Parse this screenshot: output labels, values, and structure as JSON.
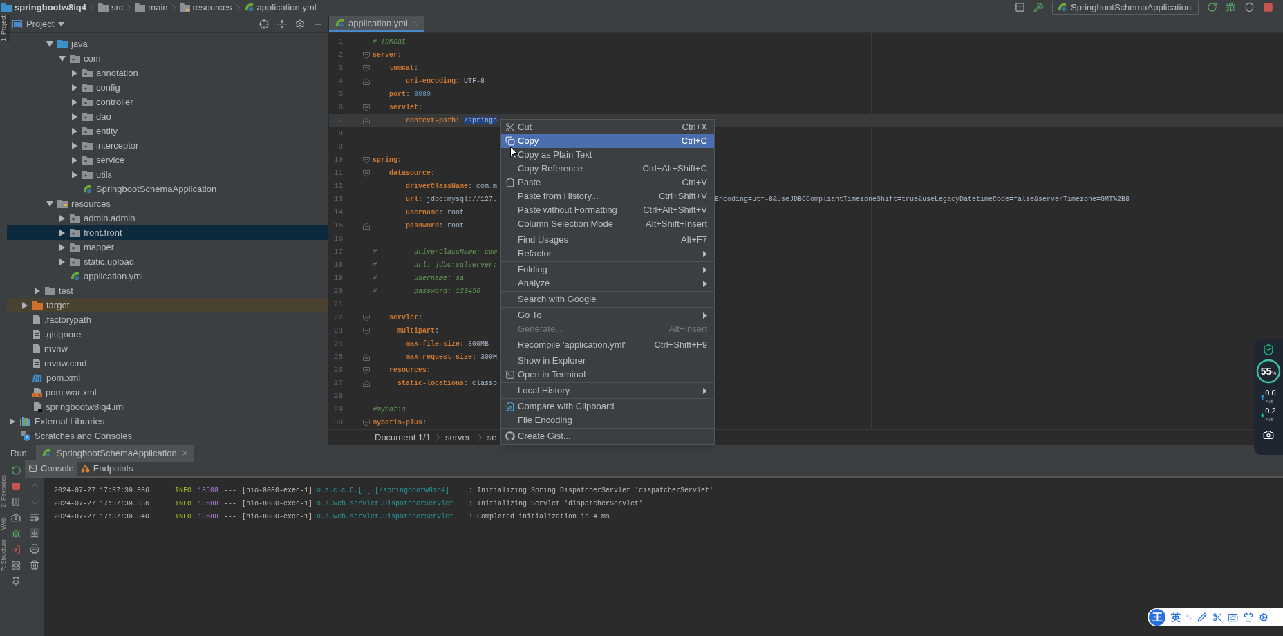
{
  "breadcrumb": [
    {
      "label": "springbootw8iq4",
      "kind": "module"
    },
    {
      "label": "src",
      "kind": "folder"
    },
    {
      "label": "main",
      "kind": "folder"
    },
    {
      "label": "resources",
      "kind": "resources"
    },
    {
      "label": "application.yml",
      "kind": "spring"
    }
  ],
  "run_configuration": {
    "label": "SpringbootSchemaApplication"
  },
  "left_strip_top": [
    "1: Project"
  ],
  "left_strip_bottom": [
    "2: Favorites",
    "Web",
    "7: Structure"
  ],
  "project_panel": {
    "title": "Project",
    "main_items": [
      {
        "label": "java",
        "kind": "source",
        "expanded": true,
        "selected": false,
        "children": [
          {
            "label": "com",
            "kind": "package",
            "expanded": true,
            "selected": false,
            "children": [
              {
                "label": "annotation",
                "kind": "package",
                "expanded": false,
                "selected": false
              },
              {
                "label": "config",
                "kind": "package",
                "expanded": false,
                "selected": false
              },
              {
                "label": "controller",
                "kind": "package",
                "expanded": false,
                "selected": false
              },
              {
                "label": "dao",
                "kind": "package",
                "expanded": false,
                "selected": false
              },
              {
                "label": "entity",
                "kind": "package",
                "expanded": false,
                "selected": false
              },
              {
                "label": "interceptor",
                "kind": "package",
                "expanded": false,
                "selected": false
              },
              {
                "label": "service",
                "kind": "package",
                "expanded": false,
                "selected": false
              },
              {
                "label": "utils",
                "kind": "package",
                "expanded": false,
                "selected": false
              },
              {
                "label": "SpringbootSchemaApplication",
                "kind": "spring",
                "selected": false
              }
            ]
          }
        ]
      },
      {
        "label": "resources",
        "kind": "resources",
        "expanded": true,
        "selected": false,
        "children": [
          {
            "label": "admin.admin",
            "kind": "package",
            "expanded": false,
            "selected": false
          },
          {
            "label": "front.front",
            "kind": "package",
            "expanded": false,
            "selected": true
          },
          {
            "label": "mapper",
            "kind": "package",
            "expanded": false,
            "selected": false
          },
          {
            "label": "static.upload",
            "kind": "package",
            "expanded": false,
            "selected": false
          },
          {
            "label": "application.yml",
            "kind": "spring",
            "selected": false
          }
        ]
      }
    ],
    "src_items": [
      {
        "label": "test",
        "kind": "folder",
        "expanded": false,
        "selected": false
      }
    ],
    "module_items": [
      {
        "label": "target",
        "kind": "excluded",
        "expanded": false,
        "selected": false
      },
      {
        "label": ".factorypath",
        "kind": "file",
        "selected": false
      },
      {
        "label": ".gitignore",
        "kind": "file",
        "selected": false
      },
      {
        "label": "mvnw",
        "kind": "file",
        "selected": false
      },
      {
        "label": "mvnw.cmd",
        "kind": "file",
        "selected": false
      },
      {
        "label": "pom.xml",
        "kind": "maven",
        "selected": false
      },
      {
        "label": "pom-war.xml",
        "kind": "xml",
        "selected": false
      },
      {
        "label": "springbootw8iq4.iml",
        "kind": "iml",
        "selected": false
      }
    ],
    "root_items": [
      {
        "label": "External Libraries",
        "kind": "libraries",
        "expanded": false,
        "selected": false
      },
      {
        "label": "Scratches and Consoles",
        "kind": "scratches",
        "selected": false
      }
    ]
  },
  "editor": {
    "tab": {
      "label": "application.yml"
    },
    "lines": [
      {
        "number": "1",
        "current": false,
        "fold_open": false,
        "fold_close": false,
        "segments": [
          {
            "text": "# Tomcat",
            "kind": "comment"
          }
        ]
      },
      {
        "number": "2",
        "current": false,
        "fold_open": true,
        "fold_close": false,
        "segments": [
          {
            "text": "server",
            "kind": "key"
          },
          {
            "text": ":",
            "kind": "colon"
          }
        ]
      },
      {
        "number": "3",
        "current": false,
        "fold_open": true,
        "fold_close": false,
        "segments": [
          {
            "text": "    tomcat",
            "kind": "key"
          },
          {
            "text": ":",
            "kind": "colon"
          }
        ]
      },
      {
        "number": "4",
        "current": false,
        "fold_open": false,
        "fold_close": true,
        "segments": [
          {
            "text": "        uri-encoding",
            "kind": "key"
          },
          {
            "text": ": ",
            "kind": "colon"
          },
          {
            "text": "UTF-8",
            "kind": "value"
          }
        ]
      },
      {
        "number": "5",
        "current": false,
        "fold_open": false,
        "fold_close": false,
        "segments": [
          {
            "text": "    port",
            "kind": "key"
          },
          {
            "text": ": ",
            "kind": "colon"
          },
          {
            "text": "8080",
            "kind": "number"
          }
        ]
      },
      {
        "number": "6",
        "current": false,
        "fold_open": true,
        "fold_close": false,
        "segments": [
          {
            "text": "    servlet",
            "kind": "key"
          },
          {
            "text": ":",
            "kind": "colon"
          }
        ]
      },
      {
        "number": "7",
        "current": true,
        "fold_open": false,
        "fold_close": true,
        "segments": [
          {
            "text": "        context-path",
            "kind": "key"
          },
          {
            "text": ": ",
            "kind": "colon"
          },
          {
            "text": "/springb",
            "kind": "selected"
          }
        ]
      },
      {
        "number": "8",
        "current": false,
        "fold_open": false,
        "fold_close": false
      },
      {
        "number": "9",
        "current": false,
        "fold_open": false,
        "fold_close": false
      },
      {
        "number": "10",
        "current": false,
        "fold_open": true,
        "fold_close": false,
        "segments": [
          {
            "text": "spring",
            "kind": "key"
          },
          {
            "text": ":",
            "kind": "colon"
          }
        ]
      },
      {
        "number": "11",
        "current": false,
        "fold_open": true,
        "fold_close": false,
        "segments": [
          {
            "text": "    datasource",
            "kind": "key"
          },
          {
            "text": ":",
            "kind": "colon"
          }
        ]
      },
      {
        "number": "12",
        "current": false,
        "fold_open": false,
        "fold_close": false,
        "segments": [
          {
            "text": "        driverClassName",
            "kind": "key"
          },
          {
            "text": ": ",
            "kind": "colon"
          },
          {
            "text": "com.m",
            "kind": "value"
          }
        ]
      },
      {
        "number": "13",
        "current": false,
        "fold_open": false,
        "fold_close": false,
        "segments": [
          {
            "text": "        url",
            "kind": "key"
          },
          {
            "text": ": ",
            "kind": "colon"
          },
          {
            "text": "jdbc:mysql://127.",
            "kind": "value"
          }
        ],
        "overflow": "Encoding=utf-8&useJDBCCompliantTimezoneShift=true&useLegacyDatetimeCode=false&serverTimezone=GMT%2B8"
      },
      {
        "number": "14",
        "current": false,
        "fold_open": false,
        "fold_close": false,
        "segments": [
          {
            "text": "        username",
            "kind": "key"
          },
          {
            "text": ": ",
            "kind": "colon"
          },
          {
            "text": "root",
            "kind": "value"
          }
        ]
      },
      {
        "number": "15",
        "current": false,
        "fold_open": false,
        "fold_close": true,
        "segments": [
          {
            "text": "        password",
            "kind": "key"
          },
          {
            "text": ": ",
            "kind": "colon"
          },
          {
            "text": "root",
            "kind": "value"
          }
        ]
      },
      {
        "number": "16",
        "current": false,
        "fold_open": false,
        "fold_close": false
      },
      {
        "number": "17",
        "current": false,
        "fold_open": false,
        "fold_close": false,
        "segments": [
          {
            "text": "#         driverClassName: com",
            "kind": "comment"
          }
        ]
      },
      {
        "number": "18",
        "current": false,
        "fold_open": false,
        "fold_close": false,
        "segments": [
          {
            "text": "#         url: jdbc:sqlserver:",
            "kind": "comment"
          }
        ]
      },
      {
        "number": "19",
        "current": false,
        "fold_open": false,
        "fold_close": false,
        "segments": [
          {
            "text": "#         username: sa",
            "kind": "comment"
          }
        ]
      },
      {
        "number": "20",
        "current": false,
        "fold_open": false,
        "fold_close": false,
        "segments": [
          {
            "text": "#         password: 123456",
            "kind": "comment"
          }
        ]
      },
      {
        "number": "21",
        "current": false,
        "fold_open": false,
        "fold_close": false
      },
      {
        "number": "22",
        "current": false,
        "fold_open": true,
        "fold_close": false,
        "segments": [
          {
            "text": "    servlet",
            "kind": "key"
          },
          {
            "text": ":",
            "kind": "colon"
          }
        ]
      },
      {
        "number": "23",
        "current": false,
        "fold_open": true,
        "fold_close": false,
        "segments": [
          {
            "text": "      multipart",
            "kind": "key"
          },
          {
            "text": ":",
            "kind": "colon"
          }
        ]
      },
      {
        "number": "24",
        "current": false,
        "fold_open": false,
        "fold_close": false,
        "segments": [
          {
            "text": "        max-file-size",
            "kind": "key"
          },
          {
            "text": ": ",
            "kind": "colon"
          },
          {
            "text": "300MB",
            "kind": "value"
          }
        ]
      },
      {
        "number": "25",
        "current": false,
        "fold_open": false,
        "fold_close": true,
        "segments": [
          {
            "text": "        max-request-size",
            "kind": "key"
          },
          {
            "text": ": ",
            "kind": "colon"
          },
          {
            "text": "300M",
            "kind": "value"
          }
        ]
      },
      {
        "number": "26",
        "current": false,
        "fold_open": true,
        "fold_close": false,
        "segments": [
          {
            "text": "    resources",
            "kind": "key"
          },
          {
            "text": ":",
            "kind": "colon"
          }
        ]
      },
      {
        "number": "27",
        "current": false,
        "fold_open": false,
        "fold_close": true,
        "segments": [
          {
            "text": "      static-locations",
            "kind": "key"
          },
          {
            "text": ": ",
            "kind": "colon"
          },
          {
            "text": "classp",
            "kind": "value"
          }
        ]
      },
      {
        "number": "28",
        "current": false,
        "fold_open": false,
        "fold_close": false
      },
      {
        "number": "29",
        "current": false,
        "fold_open": false,
        "fold_close": false,
        "segments": [
          {
            "text": "#mybatis",
            "kind": "comment"
          }
        ]
      },
      {
        "number": "30",
        "current": false,
        "fold_open": true,
        "fold_close": false,
        "segments": [
          {
            "text": "mybatis-plus",
            "kind": "key"
          },
          {
            "text": ":",
            "kind": "colon"
          }
        ]
      }
    ],
    "breadcrumb": [
      "Document 1/1",
      "server:",
      "se"
    ]
  },
  "context_menu": {
    "groups": [
      [
        {
          "label": "Cut",
          "shortcut": "Ctrl+X",
          "selected": false,
          "disabled": false,
          "submenu": false
        },
        {
          "label": "Copy",
          "shortcut": "Ctrl+C",
          "selected": true,
          "disabled": false,
          "submenu": false
        },
        {
          "label": "Copy as Plain Text",
          "selected": false,
          "disabled": false,
          "submenu": false
        },
        {
          "label": "Copy Reference",
          "shortcut": "Ctrl+Alt+Shift+C",
          "selected": false,
          "disabled": false,
          "submenu": false
        },
        {
          "label": "Paste",
          "shortcut": "Ctrl+V",
          "selected": false,
          "disabled": false,
          "submenu": false
        },
        {
          "label": "Paste from History...",
          "shortcut": "Ctrl+Shift+V",
          "selected": false,
          "disabled": false,
          "submenu": false
        },
        {
          "label": "Paste without Formatting",
          "shortcut": "Ctrl+Alt+Shift+V",
          "selected": false,
          "disabled": false,
          "submenu": false
        },
        {
          "label": "Column Selection Mode",
          "shortcut": "Alt+Shift+Insert",
          "selected": false,
          "disabled": false,
          "submenu": false
        }
      ],
      [
        {
          "label": "Find Usages",
          "shortcut": "Alt+F7",
          "selected": false,
          "disabled": false,
          "submenu": false
        },
        {
          "label": "Refactor",
          "selected": false,
          "disabled": false,
          "submenu": true
        }
      ],
      [
        {
          "label": "Folding",
          "selected": false,
          "disabled": false,
          "submenu": true
        },
        {
          "label": "Analyze",
          "selected": false,
          "disabled": false,
          "submenu": true
        }
      ],
      [
        {
          "label": "Search with Google",
          "selected": false,
          "disabled": false,
          "submenu": false
        }
      ],
      [
        {
          "label": "Go To",
          "selected": false,
          "disabled": false,
          "submenu": true
        },
        {
          "label": "Generate...",
          "shortcut": "Alt+Insert",
          "selected": false,
          "disabled": true,
          "submenu": false
        }
      ],
      [
        {
          "label": "Recompile 'application.yml'",
          "shortcut": "Ctrl+Shift+F9",
          "selected": false,
          "disabled": false,
          "submenu": false
        }
      ],
      [
        {
          "label": "Show in Explorer",
          "selected": false,
          "disabled": false,
          "submenu": false
        },
        {
          "label": "Open in Terminal",
          "selected": false,
          "disabled": false,
          "submenu": false
        }
      ],
      [
        {
          "label": "Local History",
          "selected": false,
          "disabled": false,
          "submenu": true
        }
      ],
      [
        {
          "label": "Compare with Clipboard",
          "selected": false,
          "disabled": false,
          "submenu": false
        },
        {
          "label": "File Encoding",
          "selected": false,
          "disabled": false,
          "submenu": false
        }
      ],
      [
        {
          "label": "Create Gist...",
          "selected": false,
          "disabled": false,
          "submenu": false
        }
      ]
    ]
  },
  "run_panel": {
    "label": "Run:",
    "tab": {
      "label": "SpringbootSchemaApplication"
    },
    "tabs": [
      {
        "label": "Console",
        "selected": true
      },
      {
        "label": "Endpoints",
        "selected": false
      }
    ],
    "log": [
      {
        "time": "2024-07-27 17:37:39.336",
        "level": "INFO",
        "pid": "18588",
        "sep": "---",
        "thread": "[nio-8080-exec-1]",
        "logger": "o.a.c.c.C.[.[.[/springbootw8iq4]",
        "message": ": Initializing Spring DispatcherServlet 'dispatcherServlet'"
      },
      {
        "time": "2024-07-27 17:37:39.336",
        "level": "INFO",
        "pid": "18588",
        "sep": "---",
        "thread": "[nio-8080-exec-1]",
        "logger": "o.s.web.servlet.DispatcherServlet",
        "message": ": Initializing Servlet 'dispatcherServlet'"
      },
      {
        "time": "2024-07-27 17:37:39.340",
        "level": "INFO",
        "pid": "18588",
        "sep": "---",
        "thread": "[nio-8080-exec-1]",
        "logger": "o.s.web.servlet.DispatcherServlet",
        "message": ": Completed initialization in 4 ms"
      }
    ]
  },
  "monitor_widget": {
    "percent": "55",
    "percent_sign": "%",
    "upload": "0.0",
    "upload_unit": "K/s",
    "download": "0.2",
    "download_unit": "K/s"
  },
  "ime_bar": {
    "logo": "王",
    "mode": "英"
  }
}
